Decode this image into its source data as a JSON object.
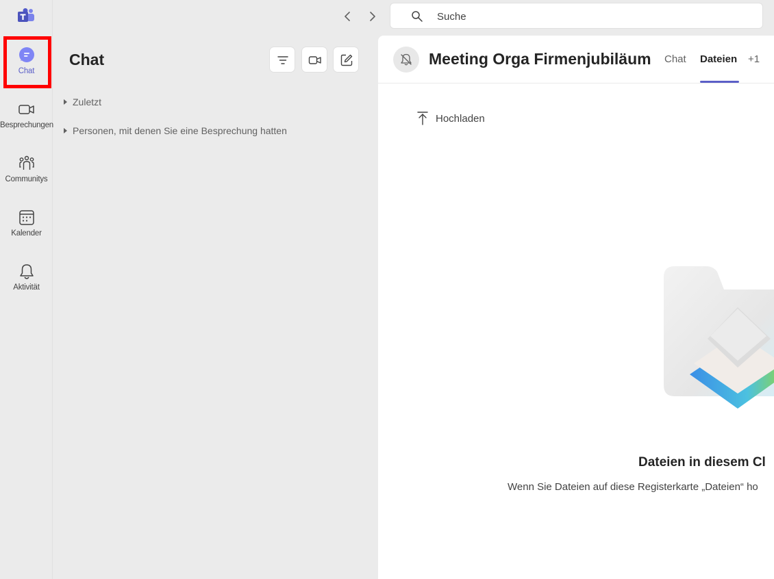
{
  "rail": {
    "items": [
      {
        "label": "Chat",
        "icon": "chat-icon",
        "active": true
      },
      {
        "label": "Besprechungen",
        "icon": "video-icon"
      },
      {
        "label": "Communitys",
        "icon": "communities-icon"
      },
      {
        "label": "Kalender",
        "icon": "calendar-icon"
      },
      {
        "label": "Aktivität",
        "icon": "bell-icon"
      }
    ]
  },
  "search": {
    "placeholder": "Suche"
  },
  "chat_pane": {
    "title": "Chat",
    "sections": [
      "Zuletzt",
      "Personen, mit denen Sie eine Besprechung hatten"
    ]
  },
  "main": {
    "title": "Meeting Orga Firmenjubiläum",
    "tabs": [
      {
        "label": "Chat"
      },
      {
        "label": "Dateien",
        "active": true
      },
      {
        "label": "+1"
      }
    ],
    "upload_label": "Hochladen",
    "empty_title": "Dateien in diesem Cl",
    "empty_text": "Wenn Sie Dateien auf diese Registerkarte „Dateien“ ho"
  },
  "colors": {
    "accent": "#5b5fc7",
    "highlight": "#ff0000"
  }
}
